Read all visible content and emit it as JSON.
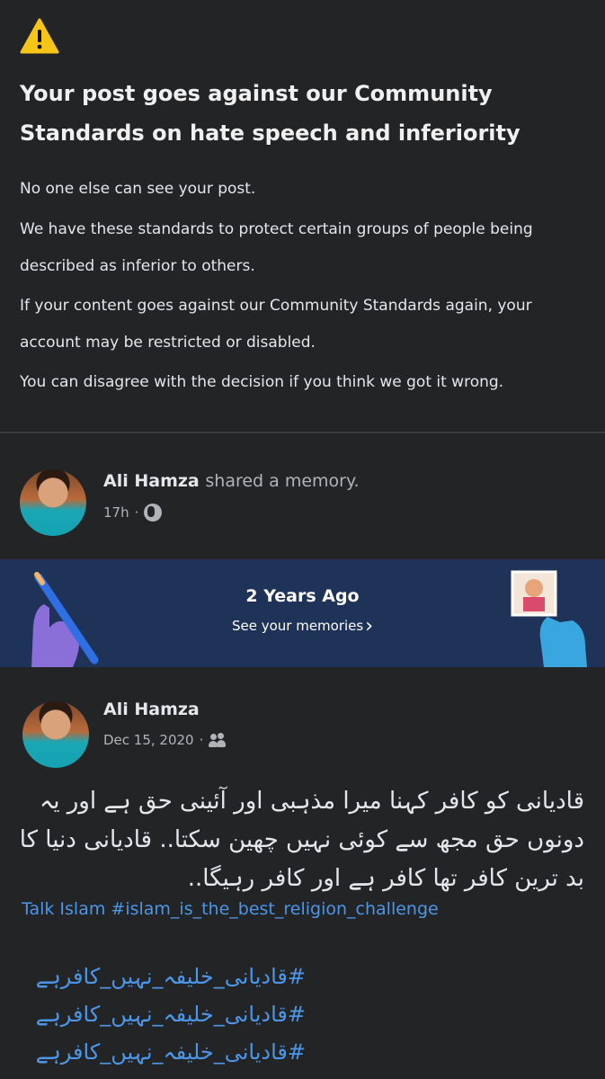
{
  "notice": {
    "title": "Your post goes against our Community Standards on hate speech and inferiority",
    "paragraphs": [
      "No one else can see your post.",
      "We have these standards to protect certain groups of people being described as inferior to others.",
      "If your content goes against our Community Standards again, your account may be restricted or disabled.",
      "You can disagree with the decision if you think we got it wrong."
    ]
  },
  "shared_post": {
    "author": "Ali Hamza",
    "action": "shared a memory.",
    "time": "17h",
    "audience_icon": "globe-icon"
  },
  "memory_banner": {
    "title": "2 Years Ago",
    "link": "See your memories",
    "colors": {
      "background": "#1f3358",
      "left_hand": "#8a6fd8",
      "right_hand": "#3aa6e0"
    }
  },
  "original_post": {
    "author": "Ali Hamza",
    "date": "Dec 15, 2020",
    "audience_icon": "friends-icon",
    "urdu_text": "قادیانی کو کافر کہنا میرا مذہبی اور آئینی حق ہے اور یہ دونوں حق مجھ سے کوئی نہیں چھین سکتا.. قادیانی دنیا کا بد ترین کافر تھا کافر ہے اور کافر رہیگا..",
    "tags_line": "Talk Islam #islam_is_the_best_religion_challenge",
    "hashtags": [
      "#قادیانی_خلیفہ_نہیں_کافرہے",
      "#قادیانی_خلیفہ_نہیں_کافرہے",
      "#قادیانی_خلیفہ_نہیں_کافرہے"
    ]
  }
}
